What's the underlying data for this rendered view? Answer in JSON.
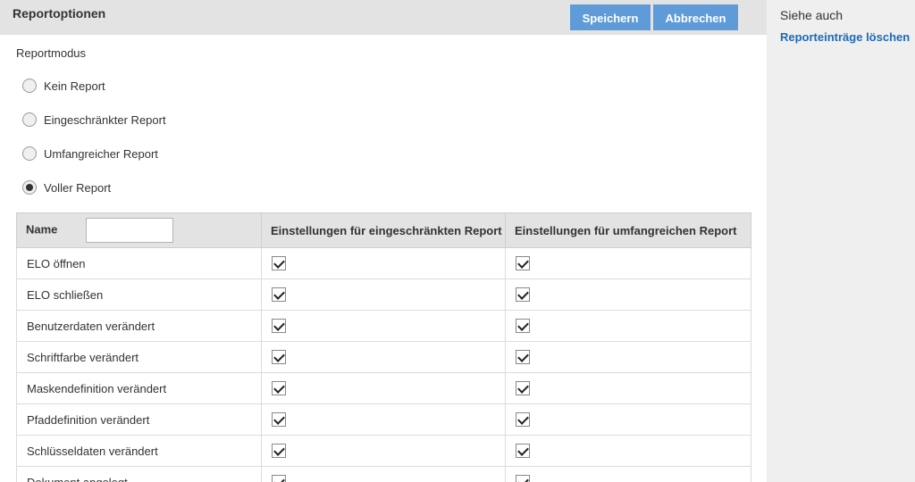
{
  "header": {
    "title": "Reportoptionen",
    "save_label": "Speichern",
    "cancel_label": "Abbrechen"
  },
  "report_mode": {
    "label": "Reportmodus",
    "options": [
      {
        "label": "Kein Report",
        "checked": false
      },
      {
        "label": "Eingeschränkter Report",
        "checked": false
      },
      {
        "label": "Umfangreicher Report",
        "checked": false
      },
      {
        "label": "Voller Report",
        "checked": true
      }
    ]
  },
  "table": {
    "columns": {
      "name": "Name",
      "restricted": "Einstellungen für eingeschränkten Report",
      "extensive": "Einstellungen für umfangreichen Report"
    },
    "name_filter_value": "",
    "rows": [
      {
        "name": "ELO öffnen",
        "restricted": true,
        "extensive": true
      },
      {
        "name": "ELO schließen",
        "restricted": true,
        "extensive": true
      },
      {
        "name": "Benutzerdaten verändert",
        "restricted": true,
        "extensive": true
      },
      {
        "name": "Schriftfarbe verändert",
        "restricted": true,
        "extensive": true
      },
      {
        "name": "Maskendefinition verändert",
        "restricted": true,
        "extensive": true
      },
      {
        "name": "Pfaddefinition verändert",
        "restricted": true,
        "extensive": true
      },
      {
        "name": "Schlüsseldaten verändert",
        "restricted": true,
        "extensive": true
      },
      {
        "name": "Dokument angelegt",
        "restricted": true,
        "extensive": true
      }
    ]
  },
  "sidebar": {
    "title": "Siehe auch",
    "link": "Reporteinträge löschen"
  },
  "colors": {
    "accent": "#5f9bd8",
    "link": "#1e6ab8",
    "header_bg": "#e3e3e3",
    "sidebar_bg": "#efefef"
  }
}
